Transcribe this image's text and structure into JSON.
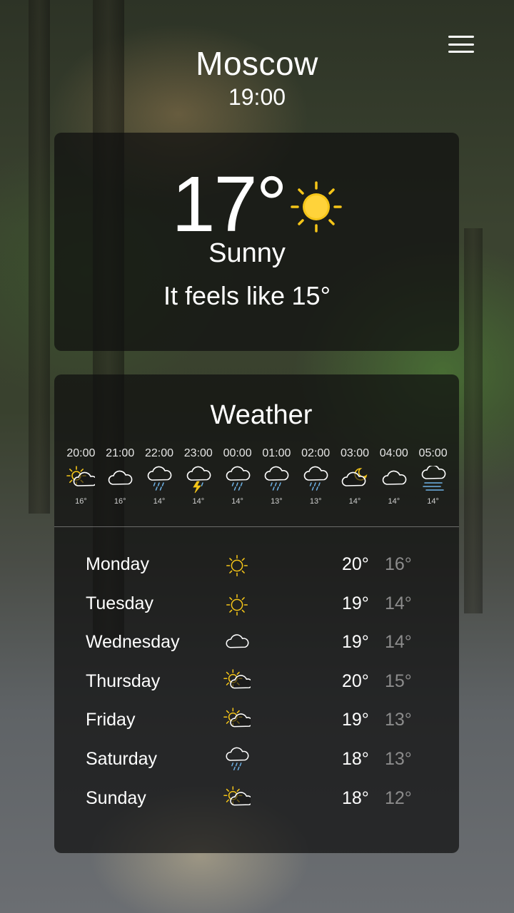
{
  "header": {
    "city": "Moscow",
    "time": "19:00"
  },
  "current": {
    "temperature": "17°",
    "condition": "Sunny",
    "feels_like_label": "It feels like",
    "feels_like_value": "15°",
    "icon": "sun-icon"
  },
  "forecast": {
    "title": "Weather",
    "hourly": [
      {
        "time": "20:00",
        "temp": "16°",
        "icon": "sun-cloud-icon"
      },
      {
        "time": "21:00",
        "temp": "16°",
        "icon": "cloud-icon"
      },
      {
        "time": "22:00",
        "temp": "14°",
        "icon": "rain-icon"
      },
      {
        "time": "23:00",
        "temp": "14°",
        "icon": "thunderstorm-icon"
      },
      {
        "time": "00:00",
        "temp": "14°",
        "icon": "rain-icon"
      },
      {
        "time": "01:00",
        "temp": "13°",
        "icon": "rain-icon"
      },
      {
        "time": "02:00",
        "temp": "13°",
        "icon": "rain-icon"
      },
      {
        "time": "03:00",
        "temp": "14°",
        "icon": "moon-cloud-icon"
      },
      {
        "time": "04:00",
        "temp": "14°",
        "icon": "cloud-icon"
      },
      {
        "time": "05:00",
        "temp": "14°",
        "icon": "fog-icon"
      }
    ],
    "daily": [
      {
        "day": "Monday",
        "high": "20°",
        "low": "16°",
        "icon": "sun-icon"
      },
      {
        "day": "Tuesday",
        "high": "19°",
        "low": "14°",
        "icon": "sun-icon"
      },
      {
        "day": "Wednesday",
        "high": "19°",
        "low": "14°",
        "icon": "cloud-icon"
      },
      {
        "day": "Thursday",
        "high": "20°",
        "low": "15°",
        "icon": "sun-cloud-icon"
      },
      {
        "day": "Friday",
        "high": "19°",
        "low": "13°",
        "icon": "sun-cloud-icon"
      },
      {
        "day": "Saturday",
        "high": "18°",
        "low": "13°",
        "icon": "rain-icon"
      },
      {
        "day": "Sunday",
        "high": "18°",
        "low": "12°",
        "icon": "sun-cloud-icon"
      }
    ]
  },
  "colors": {
    "sun": "#f5c518",
    "card_bg": "#0f0f0f",
    "low_temp": "#8c8c8c"
  }
}
